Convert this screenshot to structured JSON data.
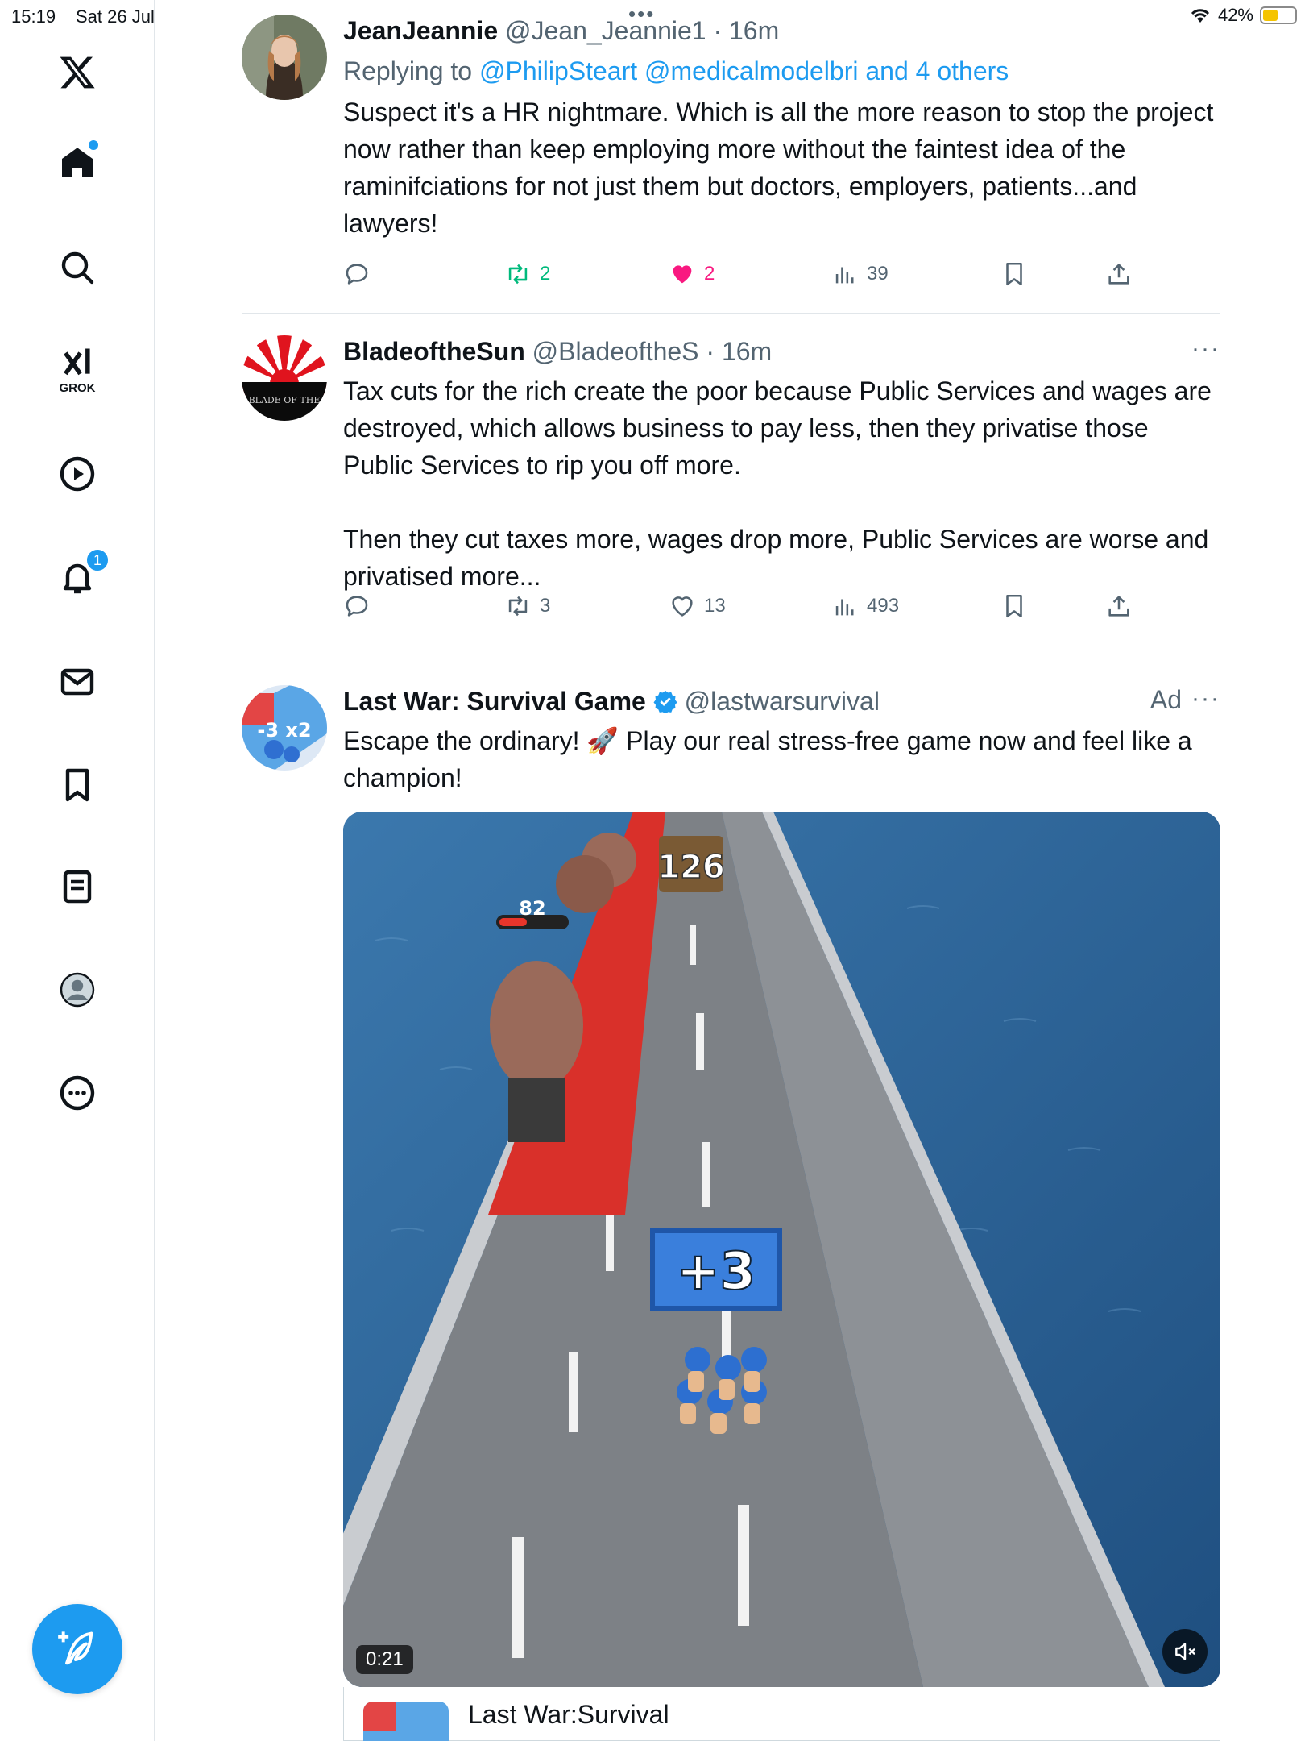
{
  "status_bar": {
    "time": "15:19",
    "date": "Sat 26 Jul",
    "battery": "42%",
    "battery_level": 0.42
  },
  "sidebar": {
    "items": [
      {
        "name": "x-logo",
        "label": ""
      },
      {
        "name": "home",
        "label": ""
      },
      {
        "name": "search",
        "label": ""
      },
      {
        "name": "grok",
        "label": "GROK"
      },
      {
        "name": "video",
        "label": ""
      },
      {
        "name": "notifications",
        "label": "",
        "badge": "1"
      },
      {
        "name": "messages",
        "label": ""
      },
      {
        "name": "bookmarks",
        "label": ""
      },
      {
        "name": "lists",
        "label": ""
      },
      {
        "name": "profile",
        "label": ""
      },
      {
        "name": "more",
        "label": ""
      }
    ],
    "accent_color": "#1d9bf0"
  },
  "tweets": [
    {
      "name": "JeanJeannie",
      "handle": "@Jean_Jeannie1",
      "time": "16m",
      "replying_prefix": "Replying to ",
      "replying_to": "@PhilipSteart @medicalmodelbri and 4 others",
      "text": "Suspect it's a HR nightmare. Which is all the more reason to stop the project now rather than keep employing more without the faintest idea of the raminifciations for not just them but doctors, employers, patients...and lawyers!",
      "replies": "",
      "reposts": "2",
      "likes": "2",
      "views": "39",
      "liked": true,
      "reposted": true
    },
    {
      "name": "BladeoftheSun",
      "handle": "@BladeoftheS",
      "time": "16m",
      "text": "Tax cuts for the rich create the poor because Public Services and wages are destroyed, which allows business to pay less, then they privatise those Public Services to rip you off more.\n\nThen they cut taxes more, wages drop more, Public Services are worse and privatised more...",
      "replies": "",
      "reposts": "3",
      "likes": "13",
      "views": "493",
      "avatar_text": "BLADE OF THE"
    },
    {
      "name": "Last War: Survival Game",
      "handle": "@lastwarsurvival",
      "ad_label": "Ad",
      "text": "Escape the ordinary! 🚀 Play our real stress-free game now and feel like a champion!",
      "video_duration": "0:21",
      "game_labels": {
        "count_top": "126",
        "enemy_hp": "82",
        "gate": "+3"
      },
      "card_title": "Last War:Survival",
      "avatar_text": "-3 x2"
    }
  ]
}
